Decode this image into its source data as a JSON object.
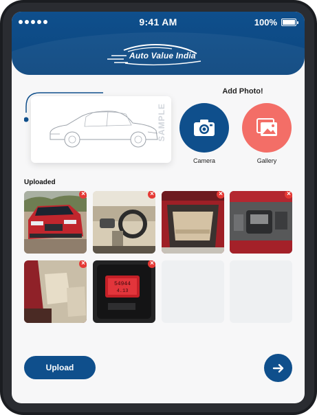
{
  "status_bar": {
    "time": "9:41 AM",
    "battery": "100%"
  },
  "header": {
    "logo_text": "Auto Value India"
  },
  "reference": {
    "watermark": "SAMPLE"
  },
  "add_photo": {
    "title": "Add Photo!",
    "camera_label": "Camera",
    "camera_icon": "camera-icon",
    "gallery_label": "Gallery",
    "gallery_icon": "gallery-icon"
  },
  "uploaded": {
    "title": "Uploaded",
    "photos": [
      {
        "subject": "exterior-front",
        "removable": true
      },
      {
        "subject": "dashboard",
        "removable": true
      },
      {
        "subject": "boot",
        "removable": true
      },
      {
        "subject": "engine-bay",
        "removable": true
      },
      {
        "subject": "front-seats",
        "removable": true
      },
      {
        "subject": "odometer",
        "removable": true,
        "odometer_reading": "54944",
        "trip_reading": "4.13"
      },
      {
        "subject": "empty-slot",
        "removable": false
      },
      {
        "subject": "empty-slot",
        "removable": false
      }
    ]
  },
  "actions": {
    "upload_label": "Upload",
    "next_icon": "arrow-right-icon"
  },
  "colors": {
    "primary": "#0f4f8c",
    "gallery": "#f36e67",
    "remove": "#e53935",
    "background": "#f7f7f8"
  }
}
